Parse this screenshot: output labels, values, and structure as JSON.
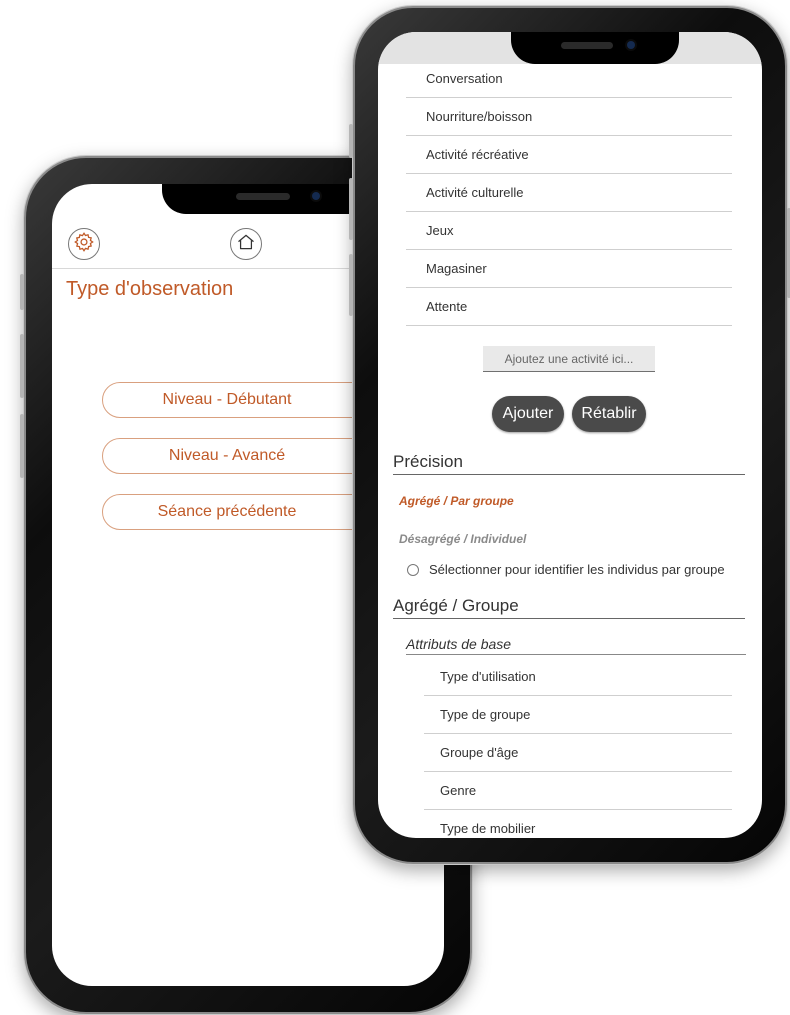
{
  "colors": {
    "accent": "#c05a28",
    "accent_border": "#d9a07f",
    "dark_button": "#4a4a4a",
    "muted": "#8a8a8a"
  },
  "left_screen": {
    "icons": {
      "settings": "gear-icon",
      "home": "home-icon"
    },
    "title": "Type d'observation",
    "levels": [
      "Niveau - Débutant",
      "Niveau - Avancé",
      "Séance précédente"
    ]
  },
  "right_screen": {
    "activities": [
      "Conversation",
      "Nourriture/boisson",
      "Activité récréative",
      "Activité culturelle",
      "Jeux",
      "Magasiner",
      "Attente"
    ],
    "add_activity": {
      "placeholder": "Ajoutez une activité ici..."
    },
    "buttons": {
      "add": "Ajouter",
      "reset": "Rétablir"
    },
    "precision": {
      "heading": "Précision",
      "aggregated": "Agrégé / Par groupe",
      "disaggregated": "Désagrégé / Individuel",
      "radio_label": "Sélectionner pour identifier les individus par groupe"
    },
    "group": {
      "heading": "Agrégé / Groupe",
      "subheading": "Attributs de base",
      "attributes": [
        "Type d'utilisation",
        "Type de groupe",
        "Groupe d'âge",
        "Genre",
        "Type de mobilier"
      ]
    }
  }
}
